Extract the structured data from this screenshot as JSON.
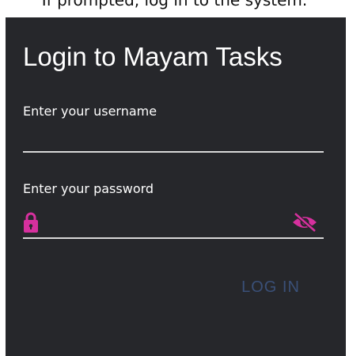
{
  "caption": "If prompted, log in to the system.",
  "form": {
    "title": "Login to Mayam Tasks",
    "username_label": "Enter your username",
    "username_value": "",
    "password_label": "Enter your password",
    "password_value": "",
    "login_label": "LOG IN"
  },
  "icons": {
    "lock": "lock-icon",
    "visibility": "eye-slash-icon"
  },
  "colors": {
    "panel_background": "#26272b",
    "accent": "#d6309e",
    "button_text": "#3a5078",
    "text": "#ffffff"
  }
}
